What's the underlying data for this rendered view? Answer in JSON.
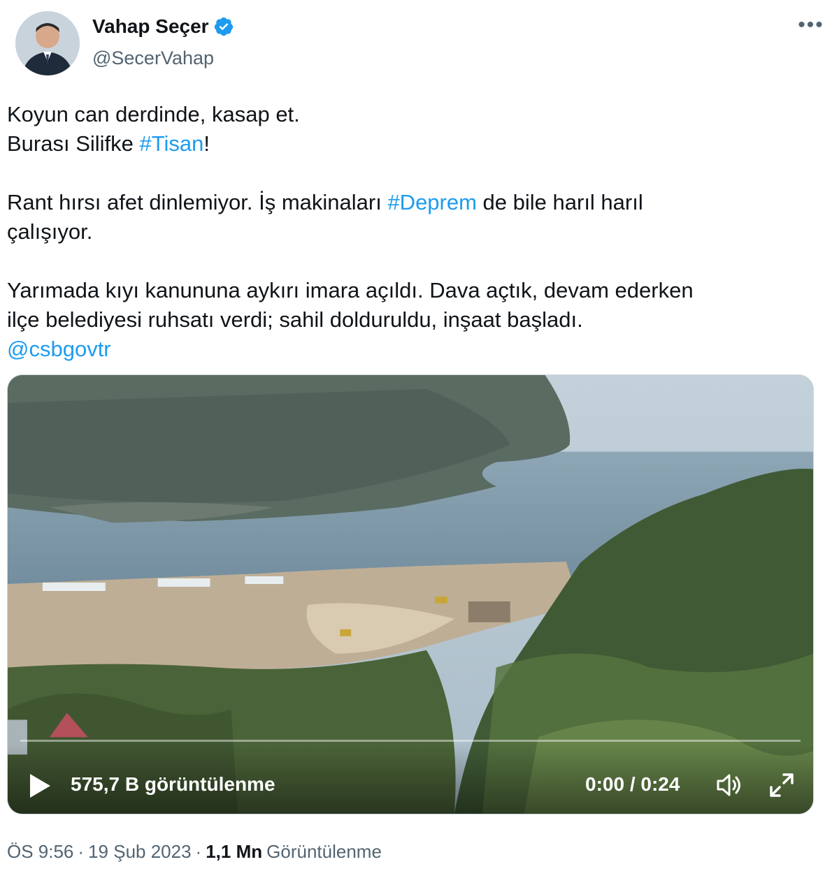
{
  "author": {
    "display_name": "Vahap Seçer",
    "handle": "@SecerVahap",
    "verified": true
  },
  "menu": {
    "more_label": "•••"
  },
  "tweet": {
    "line1": "Koyun can derdinde, kasap et.",
    "line2_pre": "Burası Silifke ",
    "hashtag_tisan": "#Tisan",
    "line2_post": "!",
    "line3_pre": "Rant hırsı afet dinlemiyor. İş makinaları ",
    "hashtag_deprem": "#Deprem",
    "line3_post": " de bile harıl harıl",
    "line4": "çalışıyor.",
    "line5": "Yarımada kıyı kanununa aykırı imara açıldı. Dava açtık, devam ederken",
    "line6": "ilçe belediyesi ruhsatı verdi; sahil dolduruldu, inşaat başladı.",
    "mention": "@csbgovtr"
  },
  "video": {
    "view_count": "575,7 B görüntülenme",
    "time": "0:00 / 0:24",
    "progress": 0
  },
  "meta": {
    "time": "ÖS 9:56",
    "separator": "·",
    "date": "19 Şub 2023",
    "views_number": "1,1 Mn",
    "views_label": "Görüntülenme"
  },
  "colors": {
    "link": "#1d9bf0",
    "verified": "#1d9bf0",
    "secondary_text": "#536471",
    "primary_text": "#0f1419"
  }
}
